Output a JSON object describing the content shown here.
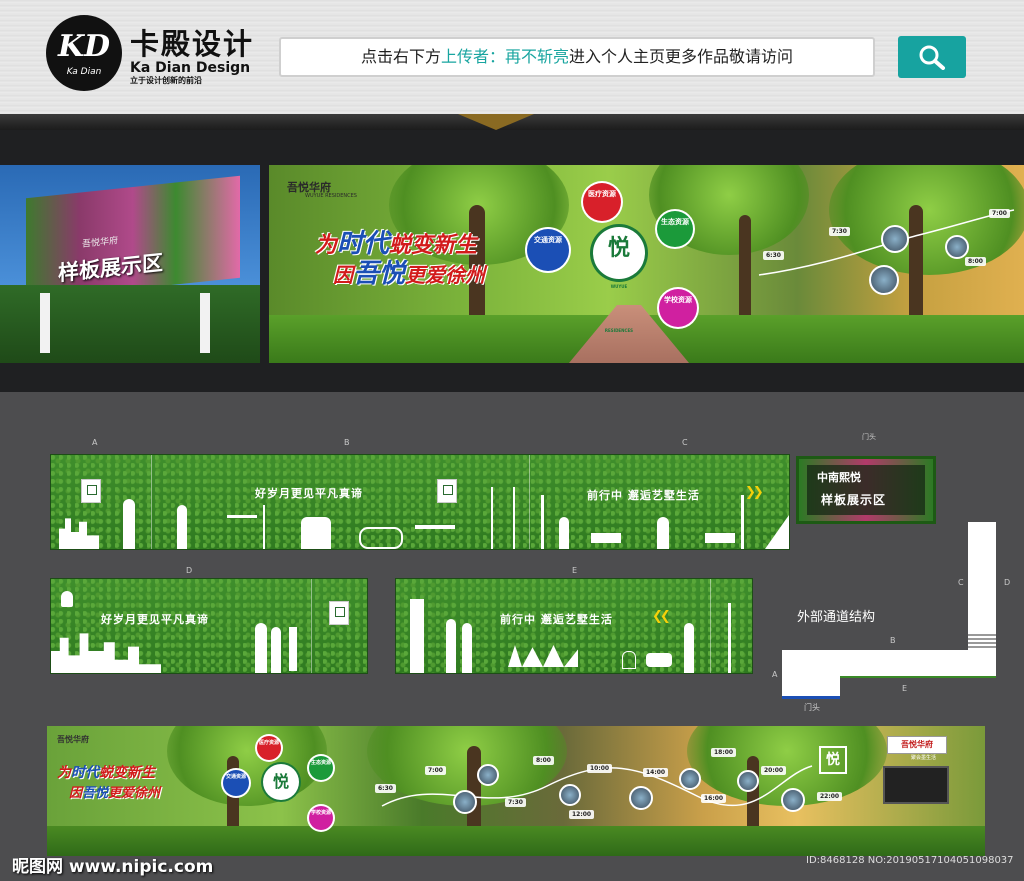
{
  "header": {
    "logo_mark": "KD",
    "logo_sub": "Ka Dian",
    "brand_cn": "卡殿设计",
    "brand_en": "Ka Dian Design",
    "brand_slogan": "立于设计创新的前沿",
    "search_prefix": "点击右下方",
    "search_highlight": "上传者：再不斩亮",
    "search_suffix": "进入个人主页更多作品敬请访问",
    "search_icon": "magnifier-icon",
    "accent_color": "#17a3a0"
  },
  "render_left": {
    "title": "样板展示区",
    "brand": "吾悦华府"
  },
  "render_main": {
    "logo": "吾悦华府",
    "logo_en": "WUYUE RESIDENCES",
    "slogan_1_pre": "为",
    "slogan_1_big": "时代",
    "slogan_1_post": "蜕变新生",
    "slogan_2_pre": "因",
    "slogan_2_big": "吾悦",
    "slogan_2_post": "更爱徐州",
    "hub_center": "悦",
    "hub_center_label": "WUYUE RESIDENCES",
    "hubs": [
      "医疗资源",
      "生态资源",
      "交通资源",
      "学校资源"
    ],
    "timeline": [
      "6:30",
      "7:30",
      "7:00",
      "8:00"
    ]
  },
  "drawings": {
    "labels": [
      "A",
      "B",
      "C",
      "D",
      "E"
    ],
    "panel_ab_text": "好岁月更见平凡真谛",
    "panel_c_text": "前行中  邂逅艺墅生活",
    "panel_d_text": "好岁月更见平凡真谛",
    "panel_e_text": "前行中  邂逅艺墅生活",
    "door_caption": "门头",
    "sign_brand": "中南熙悦",
    "sign_title": "样板展示区",
    "passage_label": "外部通道结构",
    "passage_labels": [
      "A",
      "B",
      "C",
      "D",
      "E"
    ],
    "passage_door": "门头"
  },
  "render_bottom": {
    "logo": "吾悦华府",
    "slogan_1_pre": "为",
    "slogan_1_big": "时代",
    "slogan_1_post": "蜕变新生",
    "slogan_2_pre": "因",
    "slogan_2_big": "吾悦",
    "slogan_2_post": "更爱徐州",
    "sign": "吾悦华府",
    "sign_sub": "聚会墨生活",
    "hubs": [
      "医疗资源",
      "生态资源",
      "交通资源",
      "学校资源"
    ],
    "timeline": [
      "6:30",
      "7:00",
      "7:30",
      "8:00",
      "10:00",
      "12:00",
      "14:00",
      "16:00",
      "18:00",
      "20:00",
      "22:00"
    ]
  },
  "footer": {
    "site": "昵图网 www.nipic.com",
    "id_text": "ID:8468128 NO:20190517104051098037"
  }
}
